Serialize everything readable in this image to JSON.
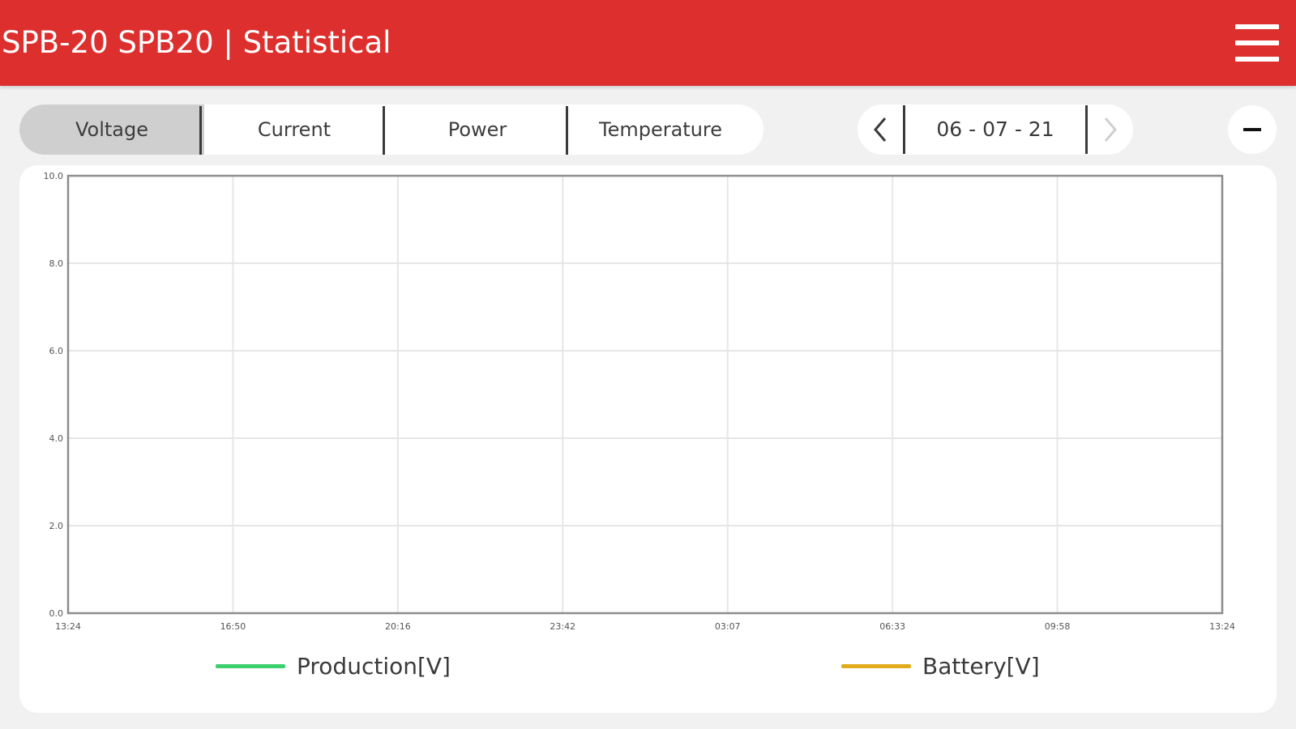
{
  "header": {
    "title": "SPB-20 SPB20 | Statistical",
    "background_color": "#dd302e",
    "menu_icon": "hamburger-menu-icon"
  },
  "tabs": [
    {
      "label": "Voltage",
      "active": true
    },
    {
      "label": "Current",
      "active": false
    },
    {
      "label": "Power",
      "active": false
    },
    {
      "label": "Temperature",
      "active": false
    }
  ],
  "date_nav": {
    "date": "06 - 07 - 21",
    "prev_icon": "chevron-left-icon",
    "next_icon": "chevron-right-icon"
  },
  "zoom": {
    "icon": "minus-icon"
  },
  "chart_data": {
    "type": "line",
    "title": "",
    "xlabel": "",
    "ylabel": "",
    "x_ticks": [
      "13:24",
      "16:50",
      "20:16",
      "23:42",
      "03:07",
      "06:33",
      "09:58",
      "13:24"
    ],
    "y_ticks": [
      "0.0",
      "2.0",
      "4.0",
      "6.0",
      "8.0",
      "10.0"
    ],
    "ylim": [
      0,
      10
    ],
    "grid": true,
    "legend_position": "bottom",
    "series": [
      {
        "name": "Production[V]",
        "color": "#3ccf6e",
        "values": []
      },
      {
        "name": "Battery[V]",
        "color": "#e0ac1c",
        "values": []
      }
    ]
  }
}
